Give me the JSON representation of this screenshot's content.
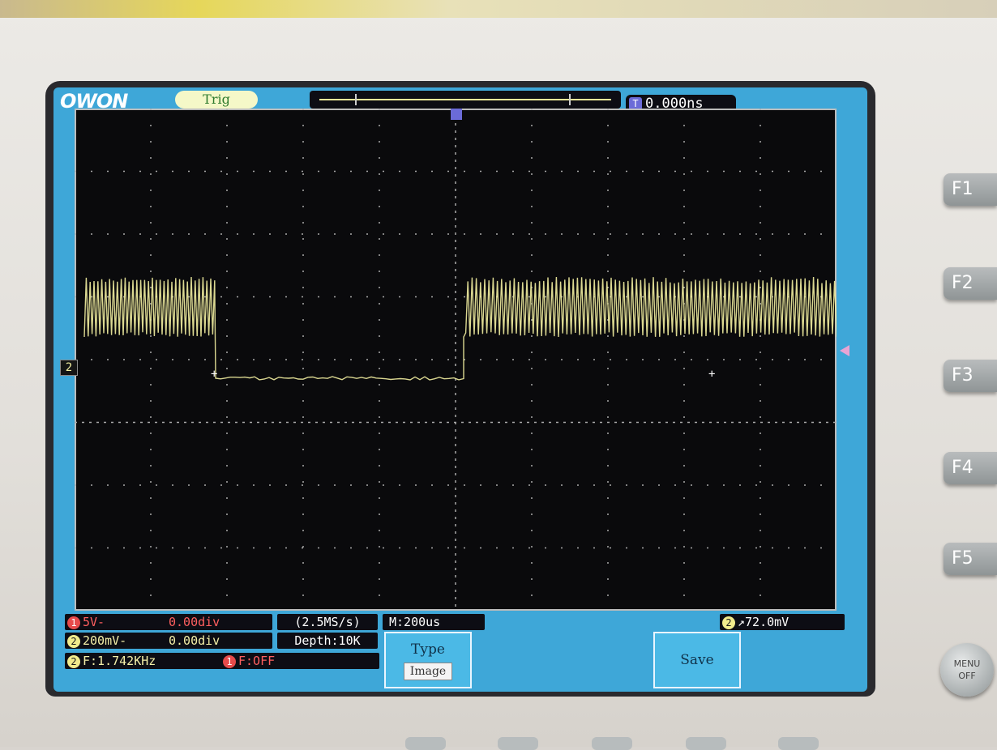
{
  "brand": "OWON",
  "header": {
    "trig_label": "Trig",
    "trigger_time": "0.000ns",
    "trigger_badge": "T"
  },
  "channel_marker": "2",
  "status": {
    "ch1_number": "1",
    "ch1_volts": "5V-",
    "ch1_offset": "0.00div",
    "ch2_number": "2",
    "ch2_volts": "200mV-",
    "ch2_offset": "0.00div",
    "sample_rate": "(2.5MS/s)",
    "depth": "Depth:10K",
    "timebase": "M:200us",
    "trigger_level": "72.0mV",
    "freq2_label": "F:1.742KHz",
    "freq1_label": "F:OFF"
  },
  "menu": {
    "type_label": "Type",
    "type_value": "Image",
    "save_label": "Save"
  },
  "function_keys": [
    "F1",
    "F2",
    "F3",
    "F4",
    "F5"
  ],
  "menu_off_label": [
    "MENU",
    "OFF"
  ],
  "colors": {
    "screen_bg": "#3ea7d8",
    "trace": "#f2eea0",
    "ch1": "#e64b4b"
  }
}
